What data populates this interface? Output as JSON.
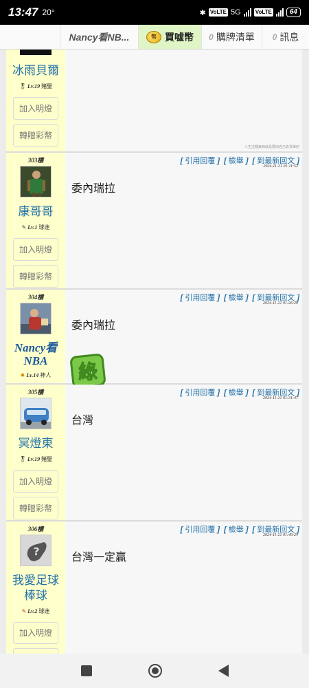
{
  "status_bar": {
    "time": "13:47",
    "temperature": "20°",
    "net_label_1": "VoLTE",
    "net_label_2": "5G",
    "net_label_3": "VoLTE",
    "battery": "64"
  },
  "tabs": {
    "board": "Nancy看NB...",
    "buy": "買嘘幣",
    "coin_glyph": "幣",
    "cart_count": "0",
    "cart": "購牌清單",
    "msg_count": "0",
    "msg": "訊息"
  },
  "actions": {
    "quote": "引用回覆",
    "report": "檢舉",
    "latest": "到最新回文",
    "bracket_open": "[",
    "bracket_close": "]"
  },
  "posts": [
    {
      "name": "冰雨貝爾",
      "level": "Lv.19",
      "rank": "賭聖",
      "btn1": "加入明燈",
      "btn2": "轉贈彩幣",
      "signature": "人生這種東西就是要由自己去買單的"
    },
    {
      "floor": "303樓",
      "name": "康哥哥",
      "level": "Lv.1",
      "rank": "球迷",
      "btn1": "加入明燈",
      "btn2": "轉贈彩幣",
      "time": "2024-11-21 01:11:52",
      "text": "委內瑞拉"
    },
    {
      "floor": "304樓",
      "name": "Nancy看NBA",
      "level": "Lv.14",
      "rank": "神人",
      "time": "2024-11-21 01:26:20",
      "text": "委內瑞拉",
      "sticker": "綠"
    },
    {
      "floor": "305樓",
      "name": "冥燈東",
      "level": "Lv.19",
      "rank": "賭聖",
      "btn1": "加入明燈",
      "btn2": "轉贈彩幣",
      "time": "2024-11-21 01:31:47",
      "text": "台灣"
    },
    {
      "floor": "306樓",
      "name": "我愛足球棒球",
      "level": "Lv.2",
      "rank": "球迷",
      "btn1": "加入明燈",
      "time": "2024-11-21 01:49:24",
      "text": "台灣一定贏"
    }
  ],
  "colors": {
    "user_col_bg": "#ffffcc",
    "link_blue": "#1f6fa8",
    "buy_tab_bg": "#dff5c6",
    "sticker_green": "#6fbf3a"
  }
}
